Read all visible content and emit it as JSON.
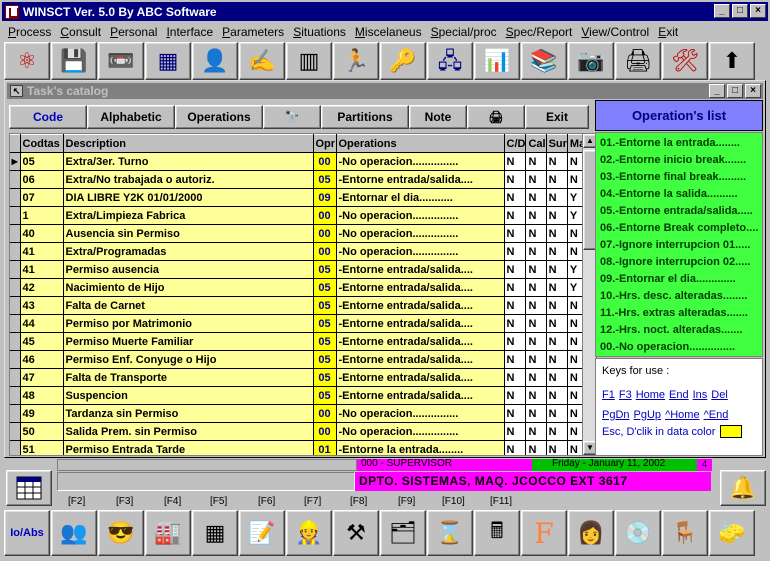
{
  "window": {
    "title": "WINSCT   Ver. 5.0  By ABC Software",
    "controls": [
      "_",
      "□",
      "×"
    ]
  },
  "menu": [
    "Process",
    "Consult",
    "Personal",
    "Interface",
    "Parameters",
    "Situations",
    "Miscelaneus",
    "Special/proc",
    "Spec/Report",
    "View/Control",
    "Exit"
  ],
  "toolbar": [
    {
      "icon": "atom-icon",
      "glyph": "⚛",
      "color": "#c00000"
    },
    {
      "icon": "floppy-disk-icon",
      "glyph": "💾",
      "color": "#000000"
    },
    {
      "icon": "cd-player-icon",
      "glyph": "📼",
      "color": "#000000"
    },
    {
      "icon": "spreadsheet-icon",
      "glyph": "▦",
      "color": "#000080"
    },
    {
      "icon": "person-icon",
      "glyph": "👤",
      "color": "#008080"
    },
    {
      "icon": "signing-icon",
      "glyph": "✍",
      "color": "#c00000"
    },
    {
      "icon": "barcode-icon",
      "glyph": "▥",
      "color": "#000000"
    },
    {
      "icon": "running-icon",
      "glyph": "🏃",
      "color": "#000000"
    },
    {
      "icon": "key-icon",
      "glyph": "🔑",
      "color": "#a08000"
    },
    {
      "icon": "network-icon",
      "glyph": "🖧",
      "color": "#000080"
    },
    {
      "icon": "bar-chart-icon",
      "glyph": "📊",
      "color": "#c000c0"
    },
    {
      "icon": "books-icon",
      "glyph": "📚",
      "color": "#008000"
    },
    {
      "icon": "camera-icon",
      "glyph": "📷",
      "color": "#000000"
    },
    {
      "icon": "printer-icon",
      "glyph": "🖨",
      "color": "#000000"
    },
    {
      "icon": "tools-icon",
      "glyph": "🛠",
      "color": "#c00000"
    },
    {
      "icon": "road-sign-icon",
      "glyph": "⬆",
      "color": "#000000"
    }
  ],
  "catalog": {
    "title": "Task's catalog",
    "buttons": [
      "Code",
      "Alphabetic",
      "Operations",
      "🔭",
      "Partitions",
      "Note",
      "🖨",
      "Exit"
    ],
    "columns": [
      "Codtas",
      "Description",
      "Opr",
      "Operations",
      "C/D",
      "Cal",
      "Sur",
      "Ma"
    ],
    "rows": [
      {
        "code": "05",
        "desc": "Extra/3er. Turno",
        "opr": "00",
        "op": "-No operacion...............",
        "cd": "N",
        "cal": "N",
        "sur": "N",
        "ma": "N"
      },
      {
        "code": "06",
        "desc": "Extra/No trabajada o autoriz.",
        "opr": "05",
        "op": "-Entorne entrada/salida....",
        "cd": "N",
        "cal": "N",
        "sur": "N",
        "ma": "N"
      },
      {
        "code": "07",
        "desc": "DIA LIBRE Y2K  01/01/2000",
        "opr": "09",
        "op": "-Entornar el dia...........",
        "cd": "N",
        "cal": "N",
        "sur": "N",
        "ma": "Y"
      },
      {
        "code": "1",
        "desc": "Extra/Limpieza Fabrica",
        "opr": "00",
        "op": "-No operacion...............",
        "cd": "N",
        "cal": "N",
        "sur": "N",
        "ma": "Y"
      },
      {
        "code": "40",
        "desc": "Ausencia sin Permiso",
        "opr": "00",
        "op": "-No operacion...............",
        "cd": "N",
        "cal": "N",
        "sur": "N",
        "ma": "N"
      },
      {
        "code": "41",
        "desc": "Extra/Programadas",
        "opr": "00",
        "op": "-No operacion...............",
        "cd": "N",
        "cal": "N",
        "sur": "N",
        "ma": "N"
      },
      {
        "code": "41",
        "desc": "Permiso ausencia",
        "opr": "05",
        "op": "-Entorne entrada/salida....",
        "cd": "N",
        "cal": "N",
        "sur": "N",
        "ma": "Y"
      },
      {
        "code": "42",
        "desc": "Nacimiento de Hijo",
        "opr": "05",
        "op": "-Entorne entrada/salida....",
        "cd": "N",
        "cal": "N",
        "sur": "N",
        "ma": "Y"
      },
      {
        "code": "43",
        "desc": "Falta de Carnet",
        "opr": "05",
        "op": "-Entorne entrada/salida....",
        "cd": "N",
        "cal": "N",
        "sur": "N",
        "ma": "N"
      },
      {
        "code": "44",
        "desc": "Permiso por Matrimonio",
        "opr": "05",
        "op": "-Entorne entrada/salida....",
        "cd": "N",
        "cal": "N",
        "sur": "N",
        "ma": "N"
      },
      {
        "code": "45",
        "desc": "Permiso Muerte Familiar",
        "opr": "05",
        "op": "-Entorne entrada/salida....",
        "cd": "N",
        "cal": "N",
        "sur": "N",
        "ma": "N"
      },
      {
        "code": "46",
        "desc": "Permiso Enf. Conyuge o Hijo",
        "opr": "05",
        "op": "-Entorne entrada/salida....",
        "cd": "N",
        "cal": "N",
        "sur": "N",
        "ma": "N"
      },
      {
        "code": "47",
        "desc": "Falta de Transporte",
        "opr": "05",
        "op": "-Entorne entrada/salida....",
        "cd": "N",
        "cal": "N",
        "sur": "N",
        "ma": "N"
      },
      {
        "code": "48",
        "desc": "Suspencion",
        "opr": "05",
        "op": "-Entorne entrada/salida....",
        "cd": "N",
        "cal": "N",
        "sur": "N",
        "ma": "N"
      },
      {
        "code": "49",
        "desc": "Tardanza sin Permiso",
        "opr": "00",
        "op": "-No operacion...............",
        "cd": "N",
        "cal": "N",
        "sur": "N",
        "ma": "N"
      },
      {
        "code": "50",
        "desc": "Salida Prem. sin Permiso",
        "opr": "00",
        "op": "-No operacion...............",
        "cd": "N",
        "cal": "N",
        "sur": "N",
        "ma": "N"
      },
      {
        "code": "51",
        "desc": "Permiso Entrada Tarde",
        "opr": "01",
        "op": "-Entorne la entrada........",
        "cd": "N",
        "cal": "N",
        "sur": "N",
        "ma": "N"
      }
    ]
  },
  "operations_list": {
    "title": "Operation's list",
    "items": [
      "01.-Entorne la entrada........",
      "02.-Entorne inicio break.......",
      "03.-Entorne final break.........",
      "04.-Entorne la salida..........",
      "05.-Entorne entrada/salida.....",
      "06.-Entorne Break completo.....",
      "07.-Ignore interrupcion 01.....",
      "08.-Ignore interrupcion 02.....",
      "09.-Entornar el dia.............",
      "10.-Hrs. desc. alteradas........",
      "11.-Hrs. extras alteradas.......",
      "12.-Hrs. noct.  alteradas.......",
      "00.-No operacion..............."
    ]
  },
  "keys": {
    "title": "Keys for use :",
    "line1": [
      "F1",
      "F3",
      "Home",
      "End",
      "Ins",
      "Del"
    ],
    "line2": [
      "PgDn",
      "PgUp",
      "^Home",
      "^End"
    ],
    "esc": "Esc, D'clik in data color"
  },
  "status": {
    "user": "000 - SUPERVISOR",
    "date": "Friday - January 11, 2002",
    "badge": "4",
    "department": "DPTO. SISTEMAS, MAQ. JCOCCO EXT 3617"
  },
  "fkeys": [
    "[F2]",
    "[F3]",
    "[F4]",
    "[F5]",
    "[F6]",
    "[F7]",
    "[F8]",
    "[F9]",
    "[F10]",
    "[F11]"
  ],
  "bottom_toolbar": [
    {
      "icon": "io-abs-icon",
      "label": "Io/Abs"
    },
    {
      "icon": "people-icon",
      "glyph": "👥"
    },
    {
      "icon": "face-sunglasses-icon",
      "glyph": "😎"
    },
    {
      "icon": "factory-icon",
      "glyph": "🏭"
    },
    {
      "icon": "table-icon",
      "glyph": "▦"
    },
    {
      "icon": "note-edit-icon",
      "glyph": "📝"
    },
    {
      "icon": "worker-icon",
      "glyph": "👷"
    },
    {
      "icon": "hammer-icon",
      "glyph": "⚒"
    },
    {
      "icon": "org-chart-icon",
      "glyph": "🗂"
    },
    {
      "icon": "hourglass-icon",
      "glyph": "⌛"
    },
    {
      "icon": "calculator-icon",
      "glyph": "🖩"
    },
    {
      "icon": "letter-f-icon",
      "glyph": "F"
    },
    {
      "icon": "woman-face-icon",
      "glyph": "👩"
    },
    {
      "icon": "disc-icon",
      "glyph": "💿"
    },
    {
      "icon": "chair-icon",
      "glyph": "🪑"
    },
    {
      "icon": "eraser-icon",
      "glyph": "🧽"
    }
  ]
}
